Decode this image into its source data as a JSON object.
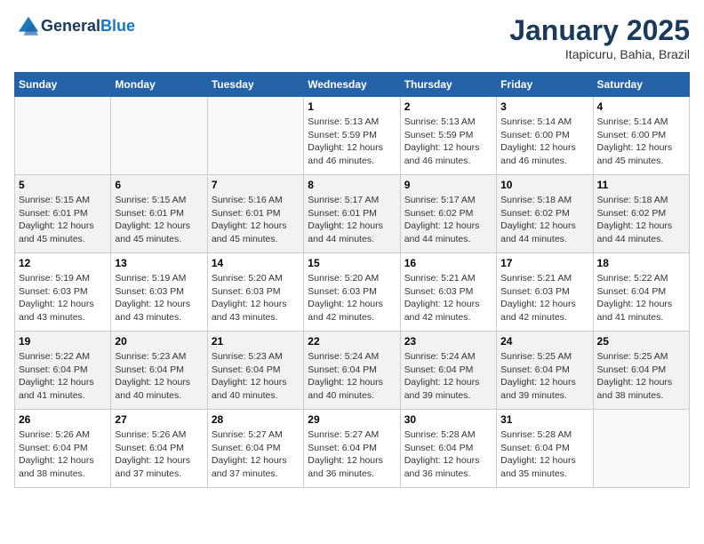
{
  "header": {
    "logo_line1": "General",
    "logo_line2": "Blue",
    "month_title": "January 2025",
    "location": "Itapicuru, Bahia, Brazil"
  },
  "days_of_week": [
    "Sunday",
    "Monday",
    "Tuesday",
    "Wednesday",
    "Thursday",
    "Friday",
    "Saturday"
  ],
  "weeks": [
    [
      {
        "day": "",
        "info": ""
      },
      {
        "day": "",
        "info": ""
      },
      {
        "day": "",
        "info": ""
      },
      {
        "day": "1",
        "info": "Sunrise: 5:13 AM\nSunset: 5:59 PM\nDaylight: 12 hours\nand 46 minutes."
      },
      {
        "day": "2",
        "info": "Sunrise: 5:13 AM\nSunset: 5:59 PM\nDaylight: 12 hours\nand 46 minutes."
      },
      {
        "day": "3",
        "info": "Sunrise: 5:14 AM\nSunset: 6:00 PM\nDaylight: 12 hours\nand 46 minutes."
      },
      {
        "day": "4",
        "info": "Sunrise: 5:14 AM\nSunset: 6:00 PM\nDaylight: 12 hours\nand 45 minutes."
      }
    ],
    [
      {
        "day": "5",
        "info": "Sunrise: 5:15 AM\nSunset: 6:01 PM\nDaylight: 12 hours\nand 45 minutes."
      },
      {
        "day": "6",
        "info": "Sunrise: 5:15 AM\nSunset: 6:01 PM\nDaylight: 12 hours\nand 45 minutes."
      },
      {
        "day": "7",
        "info": "Sunrise: 5:16 AM\nSunset: 6:01 PM\nDaylight: 12 hours\nand 45 minutes."
      },
      {
        "day": "8",
        "info": "Sunrise: 5:17 AM\nSunset: 6:01 PM\nDaylight: 12 hours\nand 44 minutes."
      },
      {
        "day": "9",
        "info": "Sunrise: 5:17 AM\nSunset: 6:02 PM\nDaylight: 12 hours\nand 44 minutes."
      },
      {
        "day": "10",
        "info": "Sunrise: 5:18 AM\nSunset: 6:02 PM\nDaylight: 12 hours\nand 44 minutes."
      },
      {
        "day": "11",
        "info": "Sunrise: 5:18 AM\nSunset: 6:02 PM\nDaylight: 12 hours\nand 44 minutes."
      }
    ],
    [
      {
        "day": "12",
        "info": "Sunrise: 5:19 AM\nSunset: 6:03 PM\nDaylight: 12 hours\nand 43 minutes."
      },
      {
        "day": "13",
        "info": "Sunrise: 5:19 AM\nSunset: 6:03 PM\nDaylight: 12 hours\nand 43 minutes."
      },
      {
        "day": "14",
        "info": "Sunrise: 5:20 AM\nSunset: 6:03 PM\nDaylight: 12 hours\nand 43 minutes."
      },
      {
        "day": "15",
        "info": "Sunrise: 5:20 AM\nSunset: 6:03 PM\nDaylight: 12 hours\nand 42 minutes."
      },
      {
        "day": "16",
        "info": "Sunrise: 5:21 AM\nSunset: 6:03 PM\nDaylight: 12 hours\nand 42 minutes."
      },
      {
        "day": "17",
        "info": "Sunrise: 5:21 AM\nSunset: 6:03 PM\nDaylight: 12 hours\nand 42 minutes."
      },
      {
        "day": "18",
        "info": "Sunrise: 5:22 AM\nSunset: 6:04 PM\nDaylight: 12 hours\nand 41 minutes."
      }
    ],
    [
      {
        "day": "19",
        "info": "Sunrise: 5:22 AM\nSunset: 6:04 PM\nDaylight: 12 hours\nand 41 minutes."
      },
      {
        "day": "20",
        "info": "Sunrise: 5:23 AM\nSunset: 6:04 PM\nDaylight: 12 hours\nand 40 minutes."
      },
      {
        "day": "21",
        "info": "Sunrise: 5:23 AM\nSunset: 6:04 PM\nDaylight: 12 hours\nand 40 minutes."
      },
      {
        "day": "22",
        "info": "Sunrise: 5:24 AM\nSunset: 6:04 PM\nDaylight: 12 hours\nand 40 minutes."
      },
      {
        "day": "23",
        "info": "Sunrise: 5:24 AM\nSunset: 6:04 PM\nDaylight: 12 hours\nand 39 minutes."
      },
      {
        "day": "24",
        "info": "Sunrise: 5:25 AM\nSunset: 6:04 PM\nDaylight: 12 hours\nand 39 minutes."
      },
      {
        "day": "25",
        "info": "Sunrise: 5:25 AM\nSunset: 6:04 PM\nDaylight: 12 hours\nand 38 minutes."
      }
    ],
    [
      {
        "day": "26",
        "info": "Sunrise: 5:26 AM\nSunset: 6:04 PM\nDaylight: 12 hours\nand 38 minutes."
      },
      {
        "day": "27",
        "info": "Sunrise: 5:26 AM\nSunset: 6:04 PM\nDaylight: 12 hours\nand 37 minutes."
      },
      {
        "day": "28",
        "info": "Sunrise: 5:27 AM\nSunset: 6:04 PM\nDaylight: 12 hours\nand 37 minutes."
      },
      {
        "day": "29",
        "info": "Sunrise: 5:27 AM\nSunset: 6:04 PM\nDaylight: 12 hours\nand 36 minutes."
      },
      {
        "day": "30",
        "info": "Sunrise: 5:28 AM\nSunset: 6:04 PM\nDaylight: 12 hours\nand 36 minutes."
      },
      {
        "day": "31",
        "info": "Sunrise: 5:28 AM\nSunset: 6:04 PM\nDaylight: 12 hours\nand 35 minutes."
      },
      {
        "day": "",
        "info": ""
      }
    ]
  ]
}
